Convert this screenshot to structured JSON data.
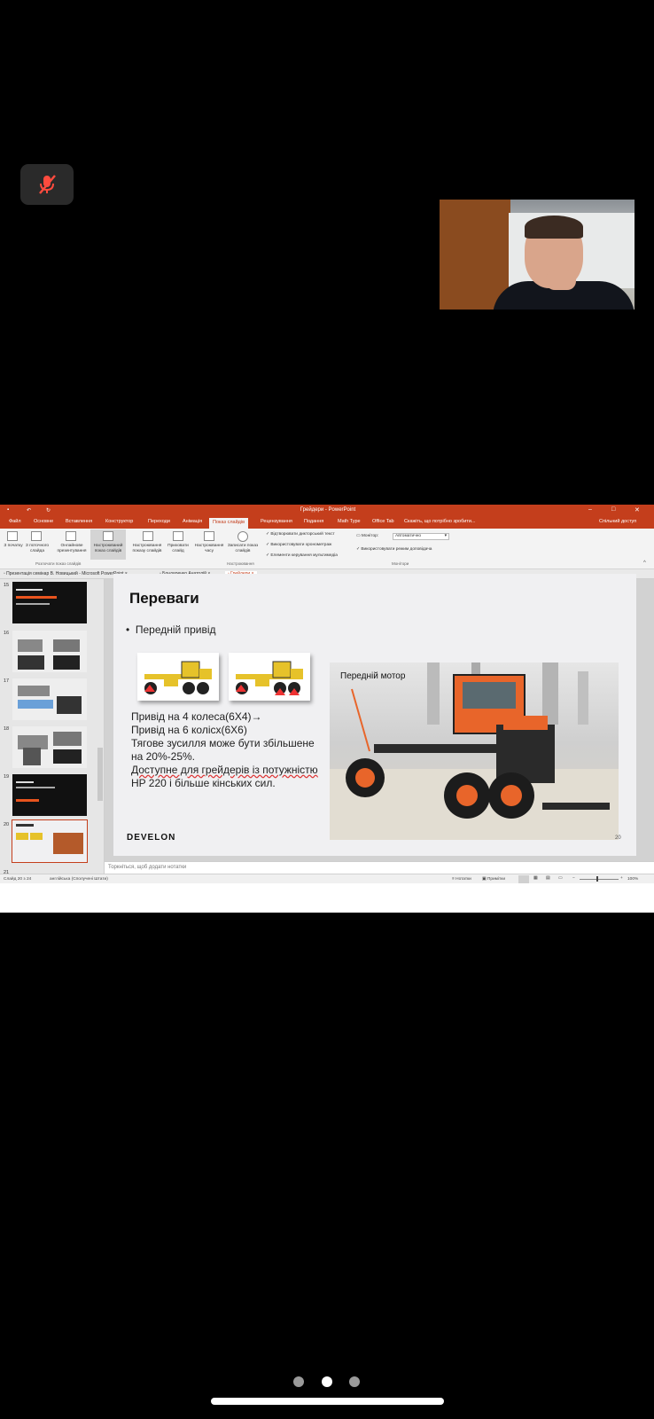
{
  "meeting": {
    "mic_state": "muted",
    "icons": [
      "mic-off-icon"
    ]
  },
  "app": {
    "title": "Грейдери - PowerPoint",
    "tabs": [
      "Файл",
      "Основне",
      "Вставлення",
      "Конструктор",
      "Переходи",
      "Анімація",
      "Показ слайдів",
      "Рецензування",
      "Подання",
      "Math Type",
      "Office Tab"
    ],
    "active_tab": "Показ слайдів",
    "search_hint": "Скажіть, що потрібно зробити...",
    "share_label": "Спільний доступ"
  },
  "ribbon": {
    "buttons": [
      "З початку",
      "З поточного слайда",
      "Онлайнове презентування",
      "Настроюваний показ слайдів",
      "Настроювання показу слайдів",
      "Приховати слайд",
      "Настроювання часу",
      "Записати показ слайдів"
    ],
    "group_start": "Розпочати показ слайдів",
    "group_setup": "Настроювання",
    "group_monitors": "Монітори",
    "checks": [
      "Відтворювати дикторський текст",
      "Використовувати хронометраж",
      "Елементи керування мультимедіа"
    ],
    "monitor_label": "Монітор:",
    "monitor_value": "Автоматично",
    "presenter_view": "Використовувати режим доповідача"
  },
  "doc_tabs": [
    "Презентація семінар В. Новицький - Microsoft PowerPoint",
    "Бондаренко Анатолій",
    "Грейдери"
  ],
  "thumbnails": [
    "15",
    "16",
    "17",
    "18",
    "19",
    "20",
    "21"
  ],
  "selected_slide": "20",
  "slide": {
    "title": "Переваги",
    "bullet": "Передній привід",
    "body_lines": [
      "Привід на 4 колеса(6X4)→",
      "Привід на 6 колісх(6Х6)",
      "Тягове зусилля може бути збільшене",
      "на 20%-25%.",
      "Доступне для грейдерів із потужністю",
      "HP 220 і більше кінських сил."
    ],
    "photo_label": "Передній мотор",
    "brand": "DEVELON",
    "number": "20"
  },
  "notes_placeholder": "Торкніться, щоб додати нотатки",
  "status": {
    "slide_of": "Слайд 20 з 24",
    "language": "англійська (Сполучені Штати)",
    "notes_btn": "Нотатки",
    "comments_btn": "Примітки",
    "zoom": "100%"
  },
  "nav_dots": 3,
  "active_dot": 1
}
